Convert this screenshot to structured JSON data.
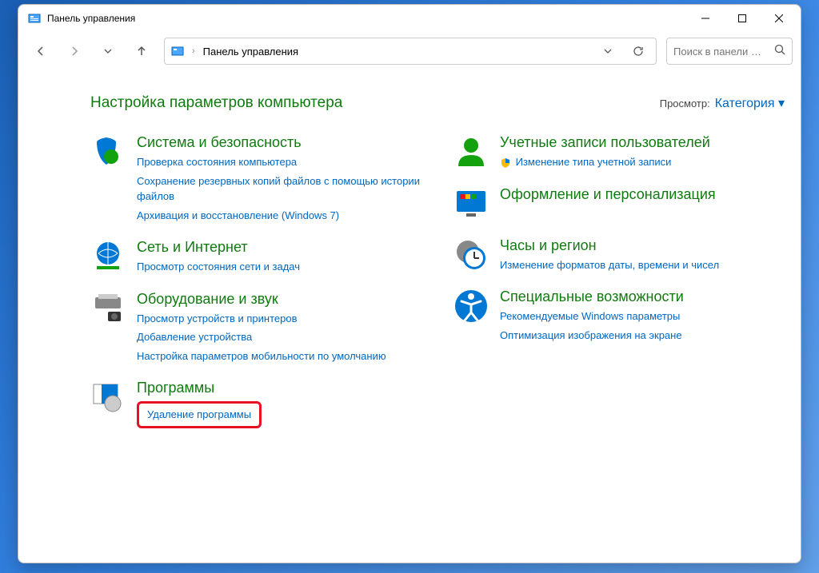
{
  "titlebar": {
    "title": "Панель управления"
  },
  "addressbar": {
    "path": "Панель управления"
  },
  "search": {
    "placeholder": "Поиск в панели …"
  },
  "header": {
    "title": "Настройка параметров компьютера",
    "viewby_label": "Просмотр:",
    "viewby_value": "Категория"
  },
  "left": [
    {
      "title": "Система и безопасность",
      "links": [
        "Проверка состояния компьютера",
        "Сохранение резервных копий файлов с помощью истории файлов",
        "Архивация и восстановление (Windows 7)"
      ]
    },
    {
      "title": "Сеть и Интернет",
      "links": [
        "Просмотр состояния сети и задач"
      ]
    },
    {
      "title": "Оборудование и звук",
      "links": [
        "Просмотр устройств и принтеров",
        "Добавление устройства",
        "Настройка параметров мобильности по умолчанию"
      ]
    },
    {
      "title": "Программы",
      "links": [
        "Удаление программы"
      ]
    }
  ],
  "right": [
    {
      "title": "Учетные записи пользователей",
      "links": [
        "Изменение типа учетной записи"
      ],
      "shield": true
    },
    {
      "title": "Оформление и персонализация",
      "links": []
    },
    {
      "title": "Часы и регион",
      "links": [
        "Изменение форматов даты, времени и чисел"
      ]
    },
    {
      "title": "Специальные возможности",
      "links": [
        "Рекомендуемые Windows параметры",
        "Оптимизация изображения на экране"
      ]
    }
  ]
}
